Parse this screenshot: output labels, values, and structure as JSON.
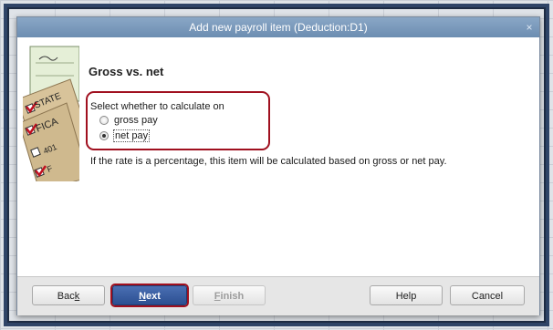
{
  "window": {
    "title": "Add new payroll item (Deduction:D1)",
    "close_glyph": "×"
  },
  "page": {
    "heading": "Gross vs. net",
    "select_label": "Select whether to calculate on",
    "options": [
      {
        "label": "gross pay",
        "selected": false
      },
      {
        "label": "net pay",
        "selected": true
      }
    ],
    "info": "If the rate is a percentage, this item will be calculated based on gross or net pay."
  },
  "illustration": {
    "labels": [
      "STATE",
      "FICA",
      "401",
      "F"
    ]
  },
  "buttons": {
    "back": {
      "pre": "Bac",
      "key": "k",
      "post": ""
    },
    "next": {
      "pre": "",
      "key": "N",
      "post": "ext"
    },
    "finish": {
      "pre": "",
      "key": "F",
      "post": "inish"
    },
    "help": "Help",
    "cancel": "Cancel"
  },
  "colors": {
    "highlight": "#a0101f",
    "primary_button": "#2c4f91",
    "titlebar": "#7a98bc"
  }
}
